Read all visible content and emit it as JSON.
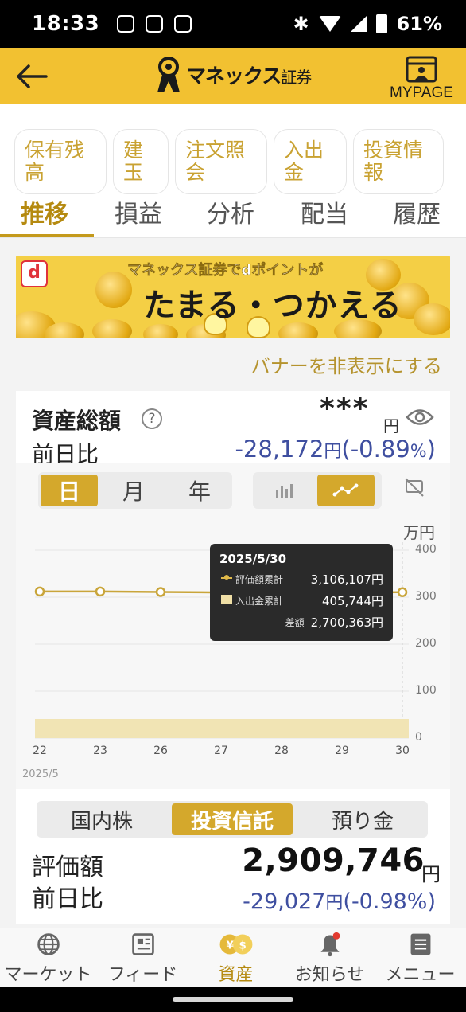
{
  "status_bar": {
    "time": "18:33",
    "battery": "61%"
  },
  "header": {
    "logo_text": "マネックス",
    "logo_suffix": "証券",
    "mypage_label": "MYPAGE"
  },
  "categories": [
    "保有残高",
    "建玉",
    "注文照会",
    "入出金",
    "投資情報"
  ],
  "sub_tabs": [
    "推移",
    "損益",
    "分析",
    "配当",
    "履歴"
  ],
  "banner": {
    "line1": "マネックス証券でdポイントが",
    "line2": "たまる・つかえる",
    "d_logo": "d",
    "hide_link": "バナーを非表示にする"
  },
  "assets": {
    "title": "資産総額",
    "help": "?",
    "masked_value": "***",
    "masked_unit": "円",
    "prev_label": "前日比",
    "prev_value": "-28,172",
    "prev_unit": "円",
    "prev_pct": "(-0.89",
    "prev_pct_unit": "%",
    "prev_pct_close": ")"
  },
  "period_tabs": [
    "日",
    "月",
    "年"
  ],
  "chart_data": {
    "type": "line",
    "unit_label": "万円",
    "y_ticks": [
      "400",
      "300",
      "200",
      "100",
      "0"
    ],
    "ylim": [
      0,
      400
    ],
    "categories": [
      "22",
      "23",
      "26",
      "27",
      "28",
      "29",
      "30"
    ],
    "year_label": "2025/5",
    "series": [
      {
        "name": "評価額累計",
        "values": [
          312,
          312,
          311,
          310,
          310,
          310,
          310.6
        ]
      },
      {
        "name": "入出金累計",
        "values": [
          40.6,
          40.6,
          40.6,
          40.6,
          40.6,
          40.6,
          40.6
        ]
      }
    ],
    "tooltip": {
      "date": "2025/5/30",
      "rows": [
        {
          "label": "評価額累計",
          "value": "3,106,107円"
        },
        {
          "label": "入出金累計",
          "value": "405,744円"
        },
        {
          "label": "差額",
          "value": "2,700,363円"
        }
      ]
    }
  },
  "asset_categories": [
    "国内株",
    "投資信託",
    "預り金"
  ],
  "valuation": {
    "label": "評価額",
    "amount": "2,909,746",
    "unit": "円",
    "prev_label": "前日比",
    "prev_value": "-29,027",
    "prev_unit": "円",
    "prev_pct": "(-0.98%)"
  },
  "bottom_nav": [
    "マーケット",
    "フィード",
    "資産",
    "お知らせ",
    "メニュー"
  ],
  "colors": {
    "header_yellow": "#f2c131",
    "accent_gold": "#d4a82c",
    "negative_blue": "#3f4fa0"
  }
}
